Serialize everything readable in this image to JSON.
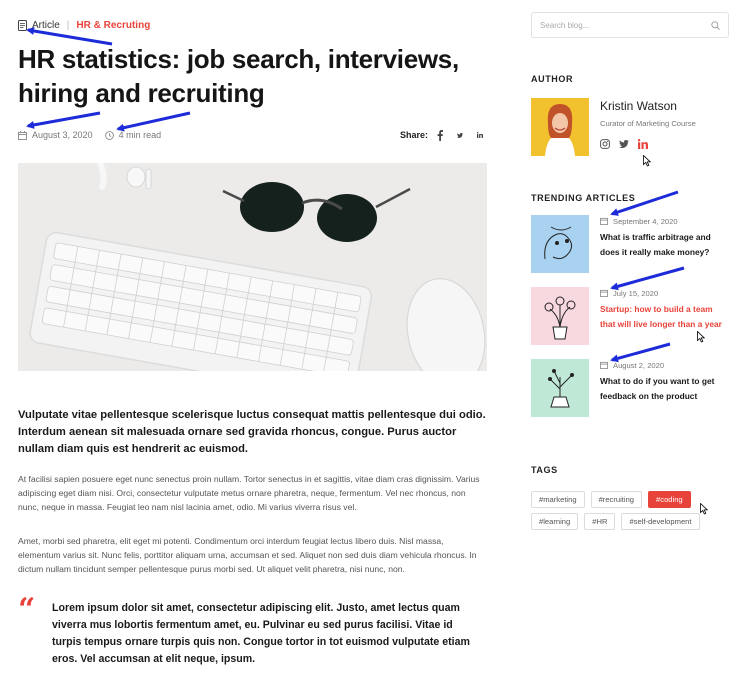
{
  "breadcrumb": {
    "category": "Article",
    "tag": "HR & Recruting"
  },
  "article": {
    "title": "HR statistics: job search,  interviews, hiring and recruiting",
    "date": "August 3, 2020",
    "read_time": "4 min read",
    "share_label": "Share:",
    "share_icons": [
      "facebook-icon",
      "twitter-icon",
      "linkedin-icon"
    ],
    "lead": "Vulputate vitae pellentesque scelerisque luctus consequat mattis pellentesque dui odio. Interdum aenean sit malesuada ornare sed gravida rhoncus, congue. Purus auctor nullam diam quis est hendrerit ac euismod.",
    "paragraphs": [
      "At facilisi sapien posuere eget nunc senectus proin nullam. Tortor senectus in et sagittis, vitae diam cras dignissim. Varius adipiscing eget diam nisi. Orci, consectetur vulputate metus ornare pharetra, neque, fermentum. Vel nec rhoncus, non nunc, neque in massa. Feugiat leo nam nisl lacinia amet, odio. Mi varius viverra risus vel.",
      "Amet, morbi sed pharetra, elit eget mi potenti. Condimentum orci interdum feugiat lectus libero duis. Nisl massa, elementum varius sit. Nunc felis, porttitor aliquam urna, accumsan et sed. Aliquet non sed duis diam vehicula rhoncus. In dictum nullam tincidunt semper pellentesque purus morbi sed. Ut aliquet velit pharetra, nisi nunc, non."
    ],
    "quote": "Lorem ipsum dolor sit amet, consectetur adipiscing elit. Justo, amet lectus quam viverra mus lobortis fermentum amet, eu. Pulvinar eu sed purus  facilisi. Vitae id turpis tempus ornare turpis quis non. Congue tortor in tot euismod vulputate etiam eros. Vel accumsan at elit neque, ipsum."
  },
  "sidebar": {
    "search_placeholder": "Search blog...",
    "author_heading": "AUTHOR",
    "author": {
      "name": "Kristin Watson",
      "role": "Curator of Marketing Course",
      "social_icons": [
        "instagram-icon",
        "twitter-icon",
        "linkedin-icon"
      ]
    },
    "trending_heading": "TRENDING ARTICLES",
    "trending": [
      {
        "date": "September 4, 2020",
        "title": "What is traffic arbitrage and does it really make money?",
        "highlighted": false,
        "thumb_color": "#a8d2f0"
      },
      {
        "date": "July 15, 2020",
        "title": "Startup: how to build a team that will live longer than a year",
        "highlighted": true,
        "thumb_color": "#f8d9df"
      },
      {
        "date": "August 2, 2020",
        "title": "What to do if you want to get feedback on the product",
        "highlighted": false,
        "thumb_color": "#bfe8d6"
      }
    ],
    "tags_heading": "TAGS",
    "tags": [
      {
        "label": "#marketing",
        "active": false
      },
      {
        "label": "#recruiting",
        "active": false
      },
      {
        "label": "#coding",
        "active": true
      },
      {
        "label": "#learning",
        "active": false
      },
      {
        "label": "#HR",
        "active": false
      },
      {
        "label": "#self-development",
        "active": false
      }
    ]
  },
  "colors": {
    "accent": "#e8433a",
    "annotation_arrow": "#1d2bd9"
  }
}
